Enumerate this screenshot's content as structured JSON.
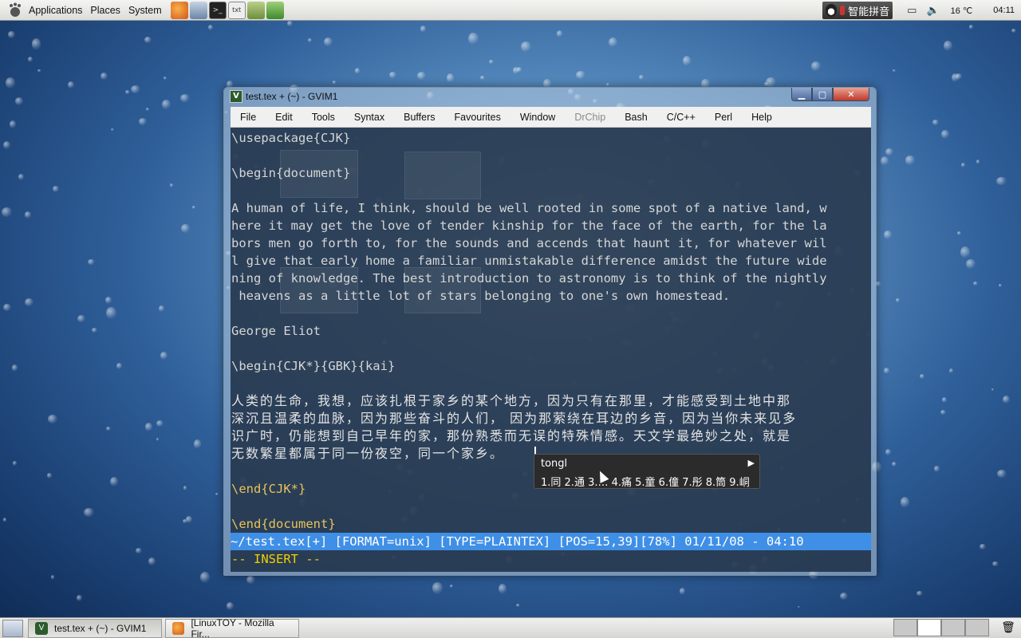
{
  "top_panel": {
    "menus": [
      "Applications",
      "Places",
      "System"
    ],
    "launchers": [
      {
        "icon": "firefox-icon"
      },
      {
        "icon": "network-icon"
      },
      {
        "icon": "terminal-icon"
      },
      {
        "icon": "text-editor-icon"
      },
      {
        "icon": "ebook-icon"
      },
      {
        "icon": "dictionary-icon"
      }
    ],
    "ime_label": "智能拼音",
    "temperature": "16 ℃",
    "clock": "04:11"
  },
  "gvim": {
    "title": "test.tex + (~) - GVIM1",
    "menu": [
      {
        "label": "File",
        "disabled": false
      },
      {
        "label": "Edit",
        "disabled": false
      },
      {
        "label": "Tools",
        "disabled": false
      },
      {
        "label": "Syntax",
        "disabled": false
      },
      {
        "label": "Buffers",
        "disabled": false
      },
      {
        "label": "Favourites",
        "disabled": false
      },
      {
        "label": "Window",
        "disabled": false
      },
      {
        "label": "DrChip",
        "disabled": true
      },
      {
        "label": "Bash",
        "disabled": false
      },
      {
        "label": "C/C++",
        "disabled": false
      },
      {
        "label": "Perl",
        "disabled": false
      },
      {
        "label": "Help",
        "disabled": false
      }
    ],
    "lines": {
      "l1": "\\usepackage{CJK}",
      "l3": "\\begin{document}",
      "p1": "A human of life, I think, should be well rooted in some spot of a native land, w",
      "p2": "here it may get the love of tender kinship for the face of the earth, for the la",
      "p3": "bors men go forth to, for the sounds and accends that haunt it, for whatever wil",
      "p4": "l give that early home a familiar unmistakable difference amidst the future wide",
      "p5": "ning of knowledge. The best introduction to astronomy is to think of the nightly",
      "p6": " heavens as a little lot of stars belonging to one's own homestead.",
      "author": "George Eliot",
      "cjk_begin": "\\begin{CJK*}{GBK}{kai}",
      "c1": "人类的生命，我想，应该扎根于家乡的某个地方，因为只有在那里，才能感受到土地中那",
      "c2": "深沉且温柔的血脉，因为那些奋斗的人们， 因为那萦绕在耳边的乡音，因为当你未来见多",
      "c3": "识广时，仍能想到自己早年的家，那份熟悉而无误的特殊情感。天文学最绝妙之处，就是",
      "c4": "无数繁星都属于同一份夜空，同一个家乡。",
      "cjk_end": "\\end{CJK*}",
      "doc_end": "\\end{document}"
    },
    "statusline": "~/test.tex[+] [FORMAT=unix] [TYPE=PLAINTEX] [POS=15,39][78%] 01/11/08 - 04:10",
    "mode": "-- INSERT --"
  },
  "ime_popup": {
    "pinyin": "tongl",
    "candidates": "1.同 2.通 3.… 4.痛 5.童 6.僮 7.彤 8.筒 9.峒"
  },
  "taskbar": {
    "tasks": [
      {
        "label": "test.tex + (~) - GVIM1",
        "icon": "gvim-icon"
      },
      {
        "label": "[LinuxTOY - Mozilla Fir...",
        "icon": "firefox-icon"
      }
    ]
  },
  "colors": {
    "statusline_bg": "#3f8fe6",
    "insert_mode": "#f0d000",
    "editor_bg": "#182a40"
  }
}
